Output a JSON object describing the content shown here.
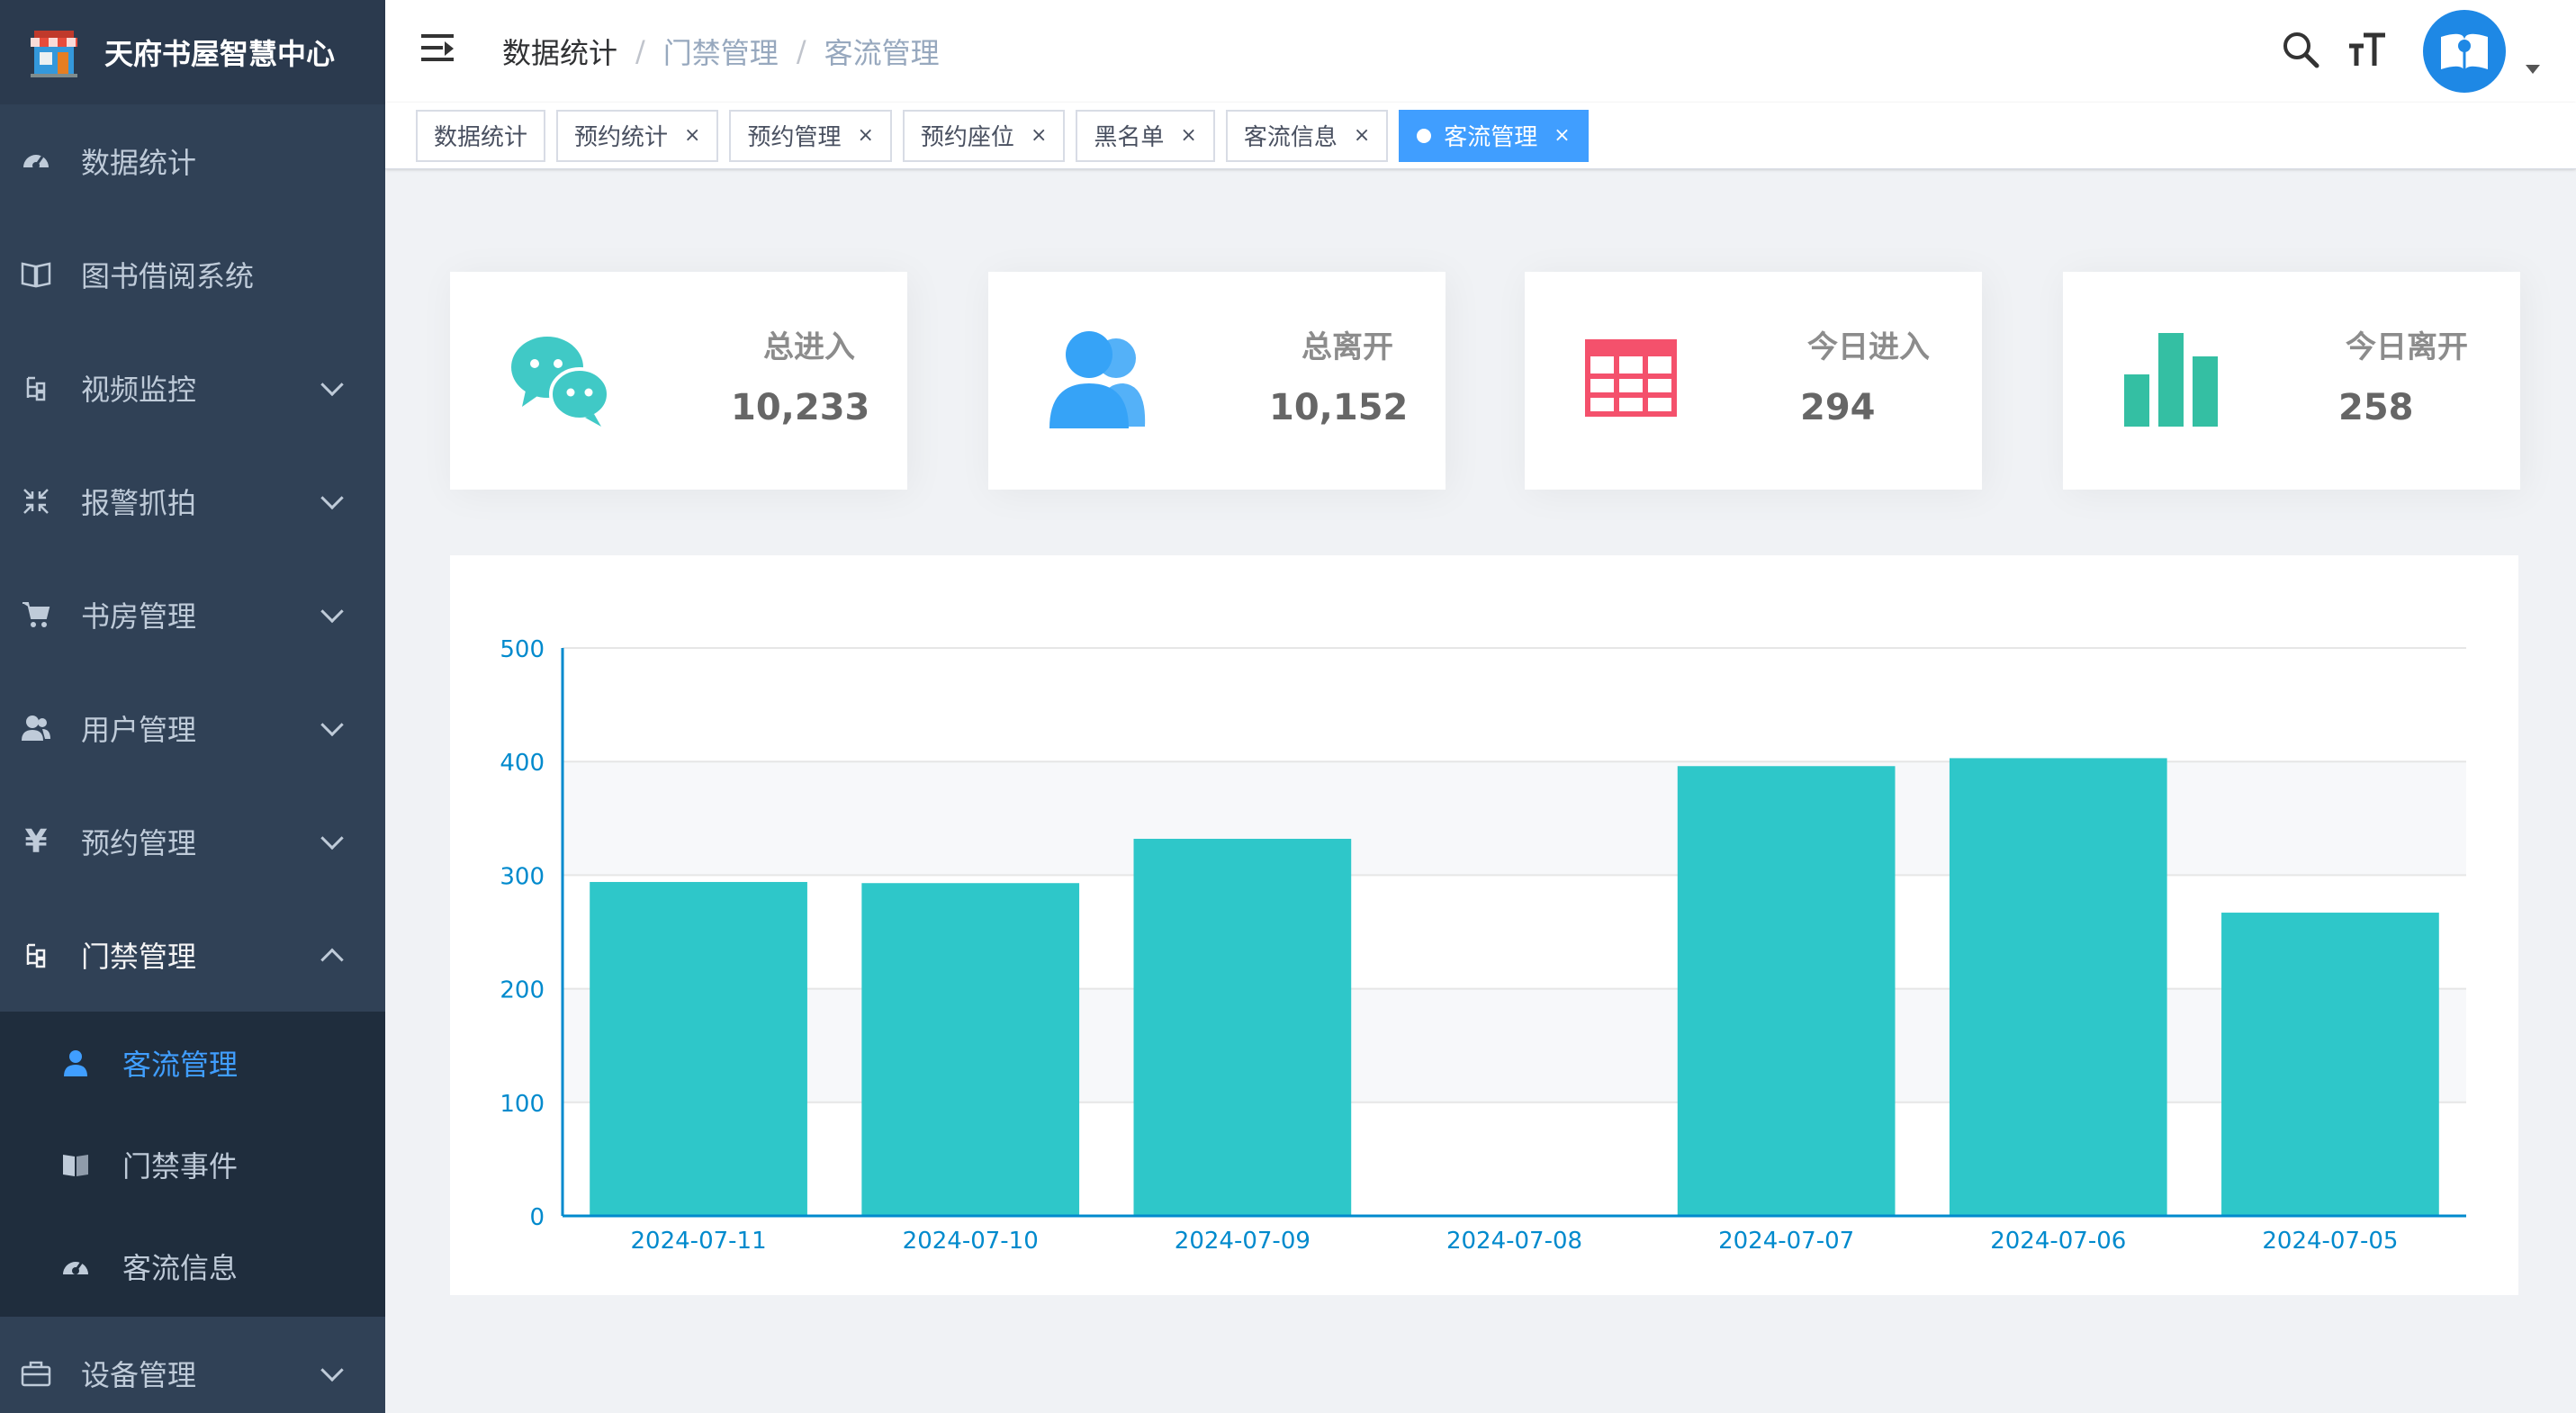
{
  "app": {
    "title": "天府书屋智慧中心"
  },
  "sidebar": {
    "items": [
      {
        "label": "数据统计",
        "icon": "dashboard-icon"
      },
      {
        "label": "图书借阅系统",
        "icon": "book-open-icon"
      },
      {
        "label": "视频监控",
        "icon": "tree-icon"
      },
      {
        "label": "报警抓拍",
        "icon": "shrink-icon"
      },
      {
        "label": "书房管理",
        "icon": "cart-icon"
      },
      {
        "label": "用户管理",
        "icon": "user-icon"
      },
      {
        "label": "预约管理",
        "icon": "yen-icon"
      },
      {
        "label": "门禁管理",
        "icon": "tree-icon"
      }
    ],
    "submenu": [
      {
        "label": "客流管理",
        "icon": "person-icon"
      },
      {
        "label": "门禁事件",
        "icon": "read-icon"
      },
      {
        "label": "客流信息",
        "icon": "dashboard-icon"
      }
    ],
    "last_item": {
      "label": "设备管理",
      "icon": "briefcase-icon"
    }
  },
  "breadcrumb": [
    "数据统计",
    "门禁管理",
    "客流管理"
  ],
  "tags": [
    {
      "label": "数据统计",
      "closable": false
    },
    {
      "label": "预约统计",
      "closable": true
    },
    {
      "label": "预约管理",
      "closable": true
    },
    {
      "label": "预约座位",
      "closable": true
    },
    {
      "label": "黑名单",
      "closable": true
    },
    {
      "label": "客流信息",
      "closable": true
    },
    {
      "label": "客流管理",
      "closable": true,
      "active": true
    }
  ],
  "cards": [
    {
      "label": "总进入",
      "value": "10,233",
      "icon": "wechat-icon",
      "color": "#40c9c6"
    },
    {
      "label": "总离开",
      "value": "10,152",
      "icon": "peoples-icon",
      "color": "#36a3f7"
    },
    {
      "label": "今日进入",
      "value": "294",
      "icon": "table-icon",
      "color": "#f4516c"
    },
    {
      "label": "今日离开",
      "value": "258",
      "icon": "bar-chart-icon",
      "color": "#34bfa3"
    }
  ],
  "chart_data": {
    "type": "bar",
    "categories": [
      "2024-07-11",
      "2024-07-10",
      "2024-07-09",
      "2024-07-08",
      "2024-07-07",
      "2024-07-06",
      "2024-07-05"
    ],
    "values": [
      294,
      293,
      332,
      0,
      396,
      403,
      267
    ],
    "ylim": [
      0,
      500
    ],
    "yticks": [
      0,
      100,
      200,
      300,
      400,
      500
    ],
    "color": "#2ec7c9",
    "grid": true
  },
  "colors": {
    "sidebar_bg": "#304156",
    "accent": "#409eff"
  }
}
